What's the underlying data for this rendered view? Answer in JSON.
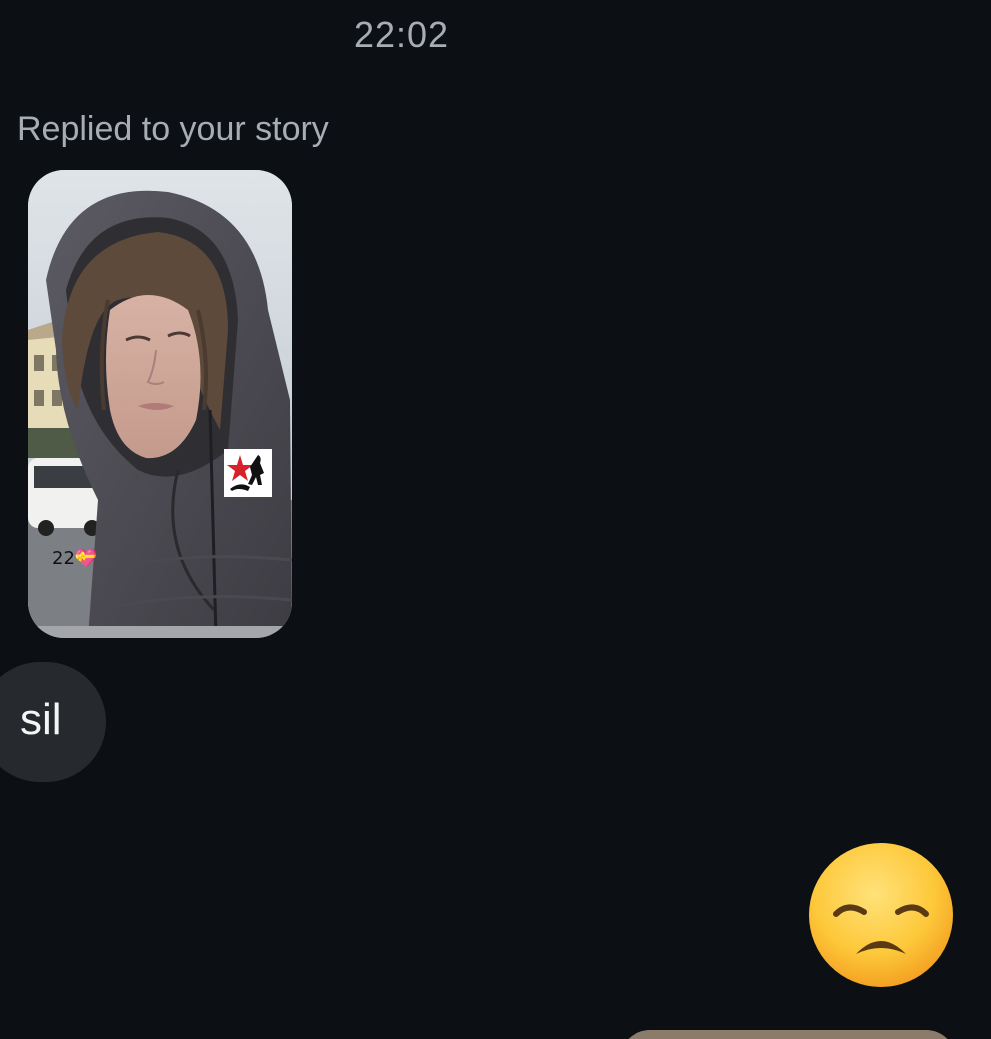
{
  "chat": {
    "timestamp": "22:02",
    "reply_label": "Replied to your story",
    "story_reply": {
      "overlay_text": "22",
      "overlay_emoji": "heart-with-ribbon-icon",
      "sticker": "star-silhouette-sticker-icon"
    },
    "messages": [
      {
        "text": "sil",
        "direction": "incoming"
      }
    ],
    "emoji_message": {
      "icon": "disappointed-face-icon",
      "direction": "outgoing"
    }
  },
  "colors": {
    "background": "#0c1014",
    "secondary_text": "#a8acb3",
    "incoming_bubble": "#262a2f",
    "message_text": "#f5f5f5"
  }
}
